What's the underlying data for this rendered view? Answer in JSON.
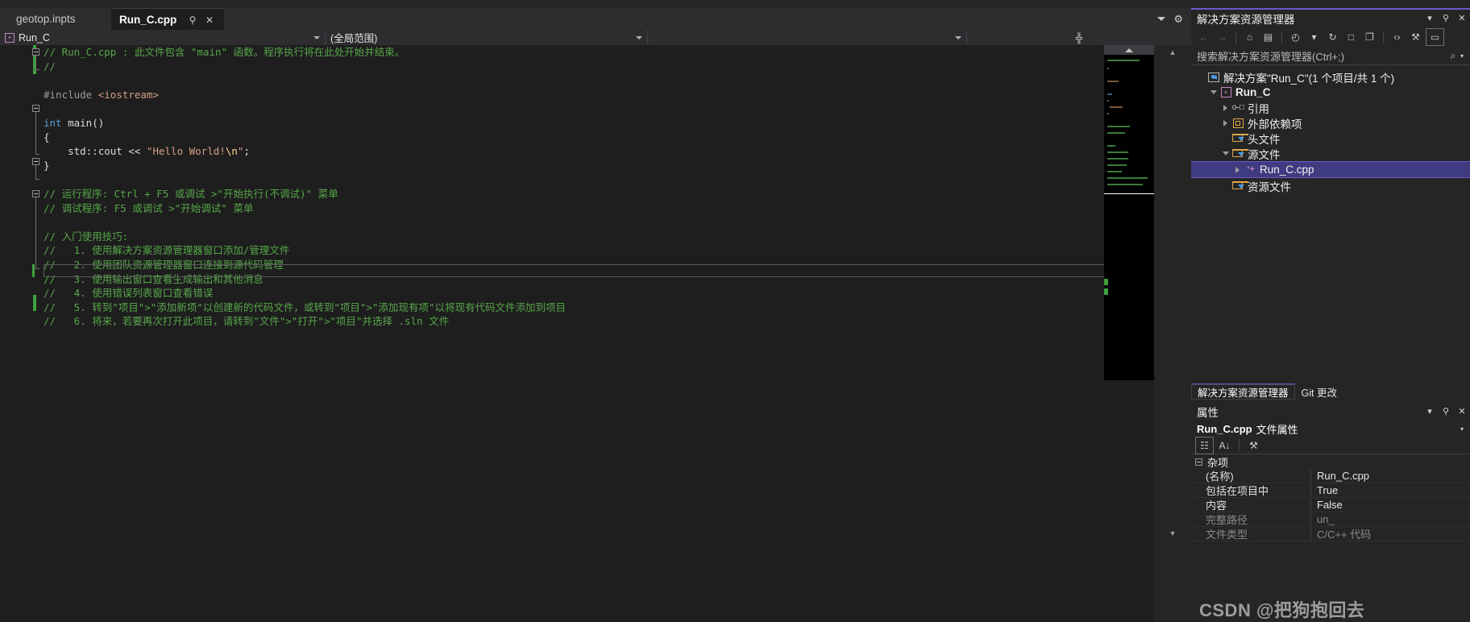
{
  "editor": {
    "tabs": [
      {
        "label": "geotop.inpts",
        "active": false
      },
      {
        "label": "Run_C.cpp",
        "active": true
      }
    ],
    "tab_pin_icon": "pin-icon",
    "tab_close_icon": "close-icon",
    "navbar": {
      "project_scope": "Run_C",
      "type_scope": "(全局范围)",
      "member_scope": ""
    },
    "code_lines": [
      {
        "indent": 0,
        "parts": [
          {
            "t": "// Run_C.cpp : 此文件包含 \"main\" 函数。程序执行将在此处开始并结束。",
            "c": "cmt"
          }
        ]
      },
      {
        "indent": 0,
        "parts": [
          {
            "t": "//",
            "c": "cmt"
          }
        ]
      },
      {
        "indent": 0,
        "parts": [
          {
            "t": "",
            "c": "pl"
          }
        ]
      },
      {
        "indent": 0,
        "parts": [
          {
            "t": "#include ",
            "c": "pp"
          },
          {
            "t": "<iostream>",
            "c": "inc"
          }
        ]
      },
      {
        "indent": 0,
        "parts": [
          {
            "t": "",
            "c": "pl"
          }
        ]
      },
      {
        "indent": 0,
        "parts": [
          {
            "t": "int",
            "c": "kw"
          },
          {
            "t": " main()",
            "c": "pl"
          }
        ]
      },
      {
        "indent": 0,
        "parts": [
          {
            "t": "{",
            "c": "pl"
          }
        ]
      },
      {
        "indent": 0,
        "parts": [
          {
            "t": "    std::cout << ",
            "c": "pl"
          },
          {
            "t": "\"Hello World!",
            "c": "str"
          },
          {
            "t": "\\n",
            "c": "esc"
          },
          {
            "t": "\"",
            "c": "str"
          },
          {
            "t": ";",
            "c": "pl"
          }
        ]
      },
      {
        "indent": 0,
        "parts": [
          {
            "t": "}",
            "c": "pl"
          }
        ]
      },
      {
        "indent": 0,
        "parts": [
          {
            "t": "",
            "c": "pl"
          }
        ]
      },
      {
        "indent": 0,
        "parts": [
          {
            "t": "// 运行程序: Ctrl + F5 或调试 >\"开始执行(不调试)\" 菜单",
            "c": "cmt"
          }
        ]
      },
      {
        "indent": 0,
        "parts": [
          {
            "t": "// 调试程序: F5 或调试 >\"开始调试\" 菜单",
            "c": "cmt"
          }
        ]
      },
      {
        "indent": 0,
        "parts": [
          {
            "t": "",
            "c": "pl"
          }
        ]
      },
      {
        "indent": 0,
        "parts": [
          {
            "t": "// 入门使用技巧: ",
            "c": "cmt"
          }
        ]
      },
      {
        "indent": 0,
        "parts": [
          {
            "t": "//   1. 使用解决方案资源管理器窗口添加/管理文件",
            "c": "cmt"
          }
        ]
      },
      {
        "indent": 0,
        "parts": [
          {
            "t": "//   2. 使用团队资源管理器窗口连接到源代码管理",
            "c": "cmt"
          }
        ]
      },
      {
        "indent": 0,
        "parts": [
          {
            "t": "//   3. 使用输出窗口查看生成输出和其他消息",
            "c": "cmt"
          }
        ]
      },
      {
        "indent": 0,
        "parts": [
          {
            "t": "//   4. 使用错误列表窗口查看错误",
            "c": "cmt"
          }
        ]
      },
      {
        "indent": 0,
        "parts": [
          {
            "t": "//   5. 转到\"项目\">\"添加新项\"以创建新的代码文件，或转到\"项目\">\"添加现有项\"以将现有代码文件添加到项目",
            "c": "cmt"
          }
        ]
      },
      {
        "indent": 0,
        "parts": [
          {
            "t": "//   6. 将来，若要再次打开此项目，请转到\"文件\">\"打开\">\"项目\"并选择 .sln 文件",
            "c": "cmt"
          }
        ]
      },
      {
        "indent": 0,
        "parts": [
          {
            "t": "",
            "c": "pl"
          }
        ]
      }
    ],
    "minimap": {
      "label": "code-minimap"
    },
    "scrollbar_up_icon": "chevron-up-icon",
    "scrollbar_down_icon": "chevron-down-icon",
    "split_icon": "split-window-icon",
    "tabstrip_overflow_icon": "chevron-down-icon",
    "tabstrip_settings_icon": "gear-icon"
  },
  "solution_explorer": {
    "title": "解决方案资源管理器",
    "dropdown_icon": "chevron-down-icon",
    "pin_icon": "pin-icon",
    "close_icon": "close-icon",
    "toolbar": [
      {
        "name": "back-icon",
        "glyph": "←",
        "dim": true
      },
      {
        "name": "forward-icon",
        "glyph": "→",
        "dim": true
      },
      {
        "name": "home-icon",
        "glyph": "⌂",
        "dim": false
      },
      {
        "name": "solution-view-icon",
        "glyph": "▤",
        "dim": false
      },
      {
        "name": "pending-changes-icon",
        "glyph": "◴",
        "dim": false
      },
      {
        "name": "pending-changes-dropdown-icon",
        "glyph": "▾",
        "dim": false
      },
      {
        "name": "refresh-icon",
        "glyph": "↻",
        "dim": false
      },
      {
        "name": "collapse-all-icon",
        "glyph": "□",
        "dim": false
      },
      {
        "name": "show-all-files-icon",
        "glyph": "❐",
        "dim": false
      },
      {
        "name": "view-code-icon",
        "glyph": "‹›",
        "dim": false
      },
      {
        "name": "properties-wrench-icon",
        "glyph": "⚒",
        "dim": false
      },
      {
        "name": "preview-selected-items-icon",
        "glyph": "▭",
        "dim": false
      }
    ],
    "search_placeholder": "搜索解决方案资源管理器(Ctrl+;)",
    "search_icon": "search-icon",
    "search_dropdown_icon": "chevron-down-icon",
    "tree": [
      {
        "label": "解决方案\"Run_C\"(1 个项目/共 1 个)",
        "indent": 0,
        "twist": "none",
        "icon": "solution-icon",
        "bold": false,
        "selected": false
      },
      {
        "label": "Run_C",
        "indent": 1,
        "twist": "down",
        "icon": "cpp-project-icon",
        "bold": true,
        "selected": false
      },
      {
        "label": "引用",
        "indent": 2,
        "twist": "right",
        "icon": "references-icon",
        "bold": false,
        "selected": false
      },
      {
        "label": "外部依赖项",
        "indent": 2,
        "twist": "right",
        "icon": "external-dependencies-icon",
        "bold": false,
        "selected": false
      },
      {
        "label": "头文件",
        "indent": 2,
        "twist": "none",
        "icon": "filter-folder-icon",
        "bold": false,
        "selected": false
      },
      {
        "label": "源文件",
        "indent": 2,
        "twist": "down",
        "icon": "filter-folder-icon",
        "bold": false,
        "selected": false
      },
      {
        "label": "Run_C.cpp",
        "indent": 3,
        "twist": "right",
        "icon": "cpp-file-icon",
        "bold": false,
        "selected": true
      },
      {
        "label": "资源文件",
        "indent": 2,
        "twist": "none",
        "icon": "filter-folder-icon",
        "bold": false,
        "selected": false
      }
    ],
    "dock_tabs": [
      {
        "label": "解决方案资源管理器",
        "active": true
      },
      {
        "label": "Git 更改",
        "active": false
      }
    ]
  },
  "properties": {
    "title": "属性",
    "dropdown_icon": "chevron-down-icon",
    "pin_icon": "pin-icon",
    "close_icon": "close-icon",
    "subject_name": "Run_C.cpp",
    "subject_suffix": "文件属性",
    "subject_dropdown_icon": "chevron-down-icon",
    "toolbar": [
      {
        "name": "categorized-icon",
        "glyph": "☷",
        "boxed": true
      },
      {
        "name": "alphabetical-sort-icon",
        "glyph": "A↓",
        "boxed": false
      },
      {
        "name": "property-pages-icon",
        "glyph": "⚒",
        "boxed": false
      }
    ],
    "category": "杂项",
    "rows": [
      {
        "key": "(名称)",
        "value": "Run_C.cpp",
        "dim": false
      },
      {
        "key": "包括在项目中",
        "value": "True",
        "dim": false
      },
      {
        "key": "内容",
        "value": "False",
        "dim": false
      },
      {
        "key": "完整路径",
        "value": "un_",
        "dim": true
      },
      {
        "key": "文件类型",
        "value": "C/C++ 代码",
        "dim": true
      }
    ]
  },
  "watermark": "CSDN @把狗抱回去",
  "colors": {
    "accent": "#6a5acd",
    "comment_green": "#57a64a",
    "keyword_blue": "#569cd6",
    "string_orange": "#d69d85",
    "selection": "#3f3b80",
    "editor_bg": "#1e1e1e",
    "chrome_bg": "#252526"
  }
}
